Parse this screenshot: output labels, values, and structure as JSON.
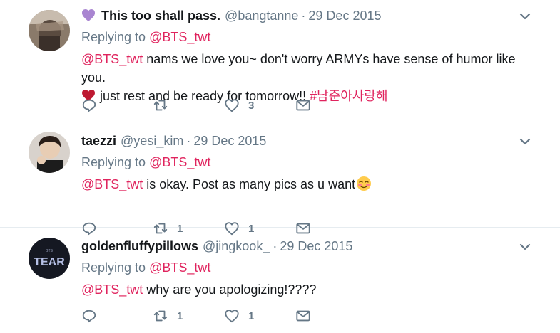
{
  "tweets": [
    {
      "name": "This too shall pass.",
      "handle": "@bangtanne",
      "sep": "·",
      "date": "29 Dec 2015",
      "replying_prefix": "Replying to",
      "replying_handle": "@BTS_twt",
      "mention": "@BTS_twt",
      "line1": " nams we love you~ don't worry ARMYs have sense of humor like you.",
      "line2_text": "just rest and be ready for tomorrow!! ",
      "hashtag": "#남준아사랑해",
      "counts": {
        "reply": "",
        "retweet": "",
        "like": "3"
      }
    },
    {
      "name": "taezzi",
      "handle": "@yesi_kim",
      "sep": "·",
      "date": "29 Dec 2015",
      "replying_prefix": "Replying to",
      "replying_handle": "@BTS_twt",
      "mention": "@BTS_twt",
      "text": " is okay. Post as many pics as u want",
      "counts": {
        "reply": "",
        "retweet": "1",
        "like": "1"
      }
    },
    {
      "name": "goldenfluffypillows",
      "handle": "@jingkook_",
      "sep": "·",
      "date": "29 Dec 2015",
      "replying_prefix": "Replying to",
      "replying_handle": "@BTS_twt",
      "mention": "@BTS_twt",
      "text": " why are you apologizing!????",
      "avatar_text_small": "BTS",
      "avatar_text": "TEAR",
      "counts": {
        "reply": "",
        "retweet": "1",
        "like": "1"
      }
    }
  ],
  "colors": {
    "link": "#e0245e",
    "muted": "#657786",
    "name": "#14171a",
    "divider": "#e6ecf0"
  },
  "icons": [
    "purple-heart-icon",
    "chevron-down-icon",
    "reply-icon",
    "retweet-icon",
    "like-icon",
    "dm-icon",
    "red-heart-icon",
    "blush-emoji-icon"
  ]
}
